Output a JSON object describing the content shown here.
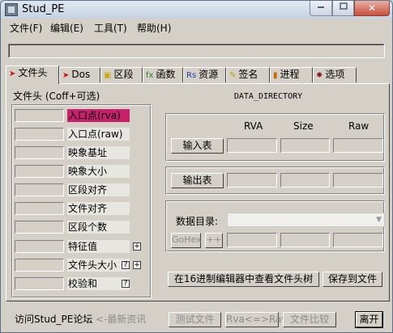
{
  "window": {
    "title": "Stud_PE"
  },
  "caption_buttons": {
    "close": "✕"
  },
  "menu": [
    "文件(F)",
    "编辑(E)",
    "工具(T)",
    "帮助(H)"
  ],
  "tabs": [
    {
      "label": "文件头",
      "icon": "arrow-icon"
    },
    {
      "label": "Dos",
      "icon": "arrow-icon"
    },
    {
      "label": "区段",
      "icon": "section-icon"
    },
    {
      "label": "函数",
      "icon": "function-icon"
    },
    {
      "label": "资源",
      "icon": "resource-icon"
    },
    {
      "label": "签名",
      "icon": "signature-icon"
    },
    {
      "label": "进程",
      "icon": "process-icon"
    },
    {
      "label": "选项",
      "icon": "options-icon"
    }
  ],
  "header_panel": {
    "title": "文件头 (Coff+可选)",
    "rows": [
      "入口点(rva)",
      "入口点(raw)",
      "映象基址",
      "映象大小",
      "区段对齐",
      "文件对齐",
      "区段个数",
      "特征值",
      "文件头大小",
      "校验和"
    ],
    "plus": "+",
    "help": "?"
  },
  "data_directory": {
    "title": "DATA_DIRECTORY",
    "columns": [
      "RVA",
      "Size",
      "Raw"
    ],
    "import_btn": "输入表",
    "export_btn": "输出表",
    "dir_label": "数据目录:",
    "gohex_btn": "GoHex",
    "plusplus_btn": "++",
    "hex_view_btn": "在16进制编辑器中查看文件头树",
    "save_btn": "保存到文件"
  },
  "footer": {
    "forum_link": "访问Stud_PE论坛",
    "news": "<-最新资讯",
    "test_btn": "测试文件",
    "rva_raw_btn": "Rva<=>Raw",
    "compare_btn": "文件比较",
    "exit_btn": "离开"
  }
}
